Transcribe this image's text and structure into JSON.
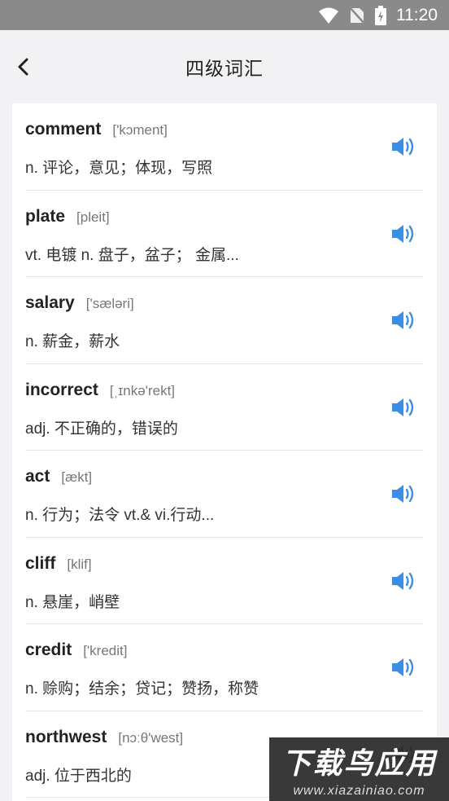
{
  "status_bar": {
    "time": "11:20"
  },
  "header": {
    "title": "四级词汇"
  },
  "words": [
    {
      "word": "comment",
      "phonetic": "['kɔment]",
      "definition": "n. 评论，意见；体现，写照"
    },
    {
      "word": "plate",
      "phonetic": "[pleit]",
      "definition": "vt. 电镀  n. 盘子，盆子；  金属..."
    },
    {
      "word": "salary",
      "phonetic": "['sæləri]",
      "definition": "n. 薪金，薪水"
    },
    {
      "word": "incorrect",
      "phonetic": "[ˌɪnkə'rekt]",
      "definition": "adj. 不正确的，错误的"
    },
    {
      "word": "act",
      "phonetic": "[ækt]",
      "definition": "n. 行为；法令  vt.& vi.行动..."
    },
    {
      "word": "cliff",
      "phonetic": "[klif]",
      "definition": "n. 悬崖，峭壁"
    },
    {
      "word": "credit",
      "phonetic": "['kredit]",
      "definition": "n. 赊购；结余；贷记；赞扬，称赞"
    },
    {
      "word": "northwest",
      "phonetic": "[nɔːθ'west]",
      "definition": "adj. 位于西北的"
    }
  ],
  "watermark": {
    "main": "下载鸟应用",
    "url": "www.xiazainiao.com"
  },
  "colors": {
    "accent": "#3a8ee6",
    "status_bar": "#8a8a8a"
  },
  "icons": {
    "back": "back-arrow-icon",
    "speaker": "speaker-icon"
  }
}
